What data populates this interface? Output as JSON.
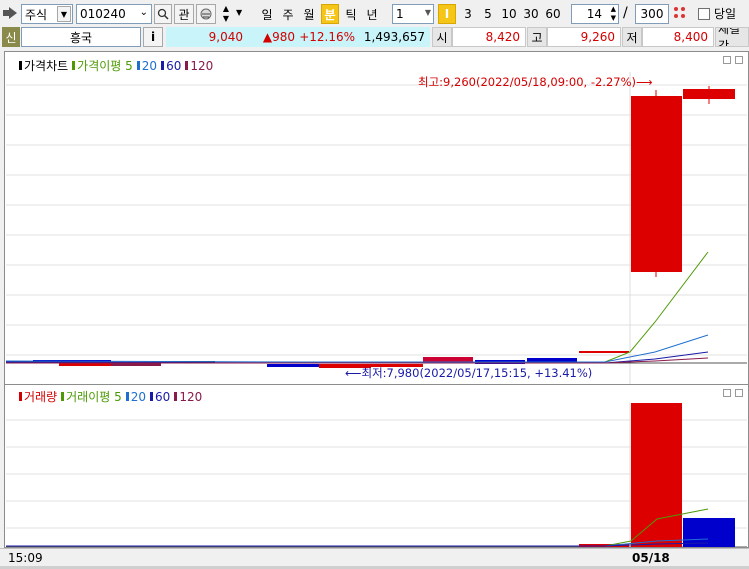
{
  "toolbar": {
    "market": "주식",
    "code": "010240",
    "fav_label": "관",
    "periods": [
      "일",
      "주",
      "월",
      "분",
      "틱",
      "년"
    ],
    "active_period": "분",
    "interval_value": "1",
    "interval_marker": "I",
    "intervals": [
      "3",
      "5",
      "10",
      "30",
      "60"
    ],
    "count_value": "14",
    "count_sep": "/",
    "count_total": "300",
    "today_label": "당일"
  },
  "info": {
    "badge": "신",
    "name": "흥국",
    "info_icon": "i",
    "price": "9,040",
    "change": "▲980",
    "change_pct": "+12.16%",
    "volume": "1,493,657",
    "open_label": "시",
    "open": "8,420",
    "high_label": "고",
    "high": "9,260",
    "low_label": "저",
    "low": "8,400",
    "trade_label": "체결강"
  },
  "price_chart": {
    "legend": [
      {
        "text": "가격차트",
        "color": "#000000"
      },
      {
        "text": "가격이평 5",
        "color": "#4e9a06"
      },
      {
        "text": "20",
        "color": "#1f6fd0"
      },
      {
        "text": "60",
        "color": "#1a1aa8"
      },
      {
        "text": "120",
        "color": "#8a1a4a"
      }
    ],
    "high_annotation": "최고:9,260(2022/05/18,09:00, -2.27%)⟶",
    "low_annotation": "⟵최저:7,980(2022/05/17,15:15, +13.41%)"
  },
  "volume_chart": {
    "legend": [
      {
        "text": "거래량",
        "color": "#d40000"
      },
      {
        "text": "거래이평 5",
        "color": "#4e9a06"
      },
      {
        "text": "20",
        "color": "#1f6fd0"
      },
      {
        "text": "60",
        "color": "#1a1aa8"
      },
      {
        "text": "120",
        "color": "#8a1a4a"
      }
    ]
  },
  "axis": {
    "time_start": "15:09",
    "date_label": "05/18"
  },
  "chart_data": {
    "type": "candlestick",
    "price_high": 9260,
    "price_low": 7980,
    "high_time": "2022/05/18,09:00",
    "low_time": "2022/05/17,15:15",
    "price_gridlines": true,
    "volume_gridlines": true
  },
  "colors": {
    "up": "#dd0000",
    "down": "#0000cc",
    "accent": "#f5c518",
    "info_bg": "#c8f4fa"
  }
}
